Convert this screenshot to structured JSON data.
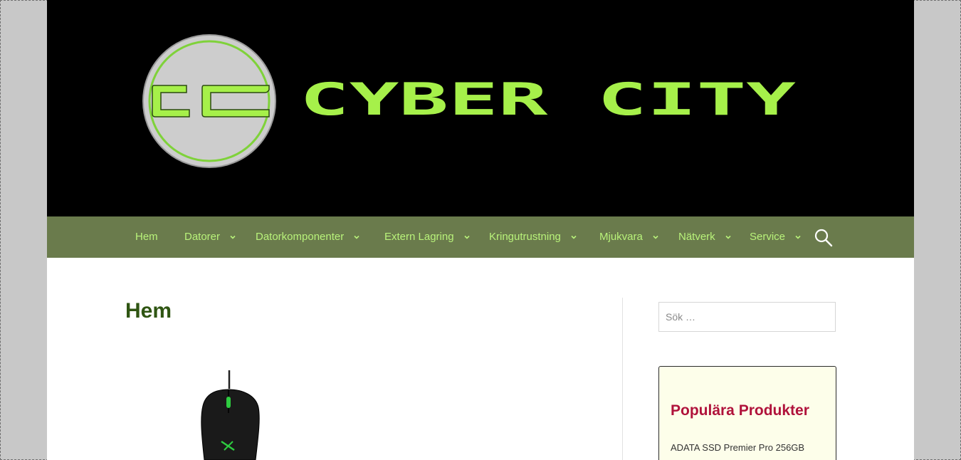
{
  "site": {
    "logo_letters": "CC",
    "name": "CYBER CITY",
    "brand_color": "#a6f04a"
  },
  "nav": {
    "items": [
      {
        "label": "Hem",
        "has_dropdown": false
      },
      {
        "label": "Datorer",
        "has_dropdown": true
      },
      {
        "label": "Datorkomponenter",
        "has_dropdown": true
      },
      {
        "label": "Extern Lagring",
        "has_dropdown": true
      },
      {
        "label": "Kringutrustning",
        "has_dropdown": true
      },
      {
        "label": "Mjukvara",
        "has_dropdown": true
      },
      {
        "label": "Nätverk",
        "has_dropdown": true
      },
      {
        "label": "Service",
        "has_dropdown": true
      }
    ],
    "search_icon": "search-icon",
    "text_color": "#b8f27a",
    "background": "#6a7b4c"
  },
  "main": {
    "title": "Hem",
    "image": "gaming-mouse"
  },
  "sidebar": {
    "search": {
      "placeholder": "Sök …"
    },
    "widget": {
      "title": "Populära Produkter",
      "items": [
        "ADATA SSD Premier Pro 256GB"
      ]
    }
  }
}
